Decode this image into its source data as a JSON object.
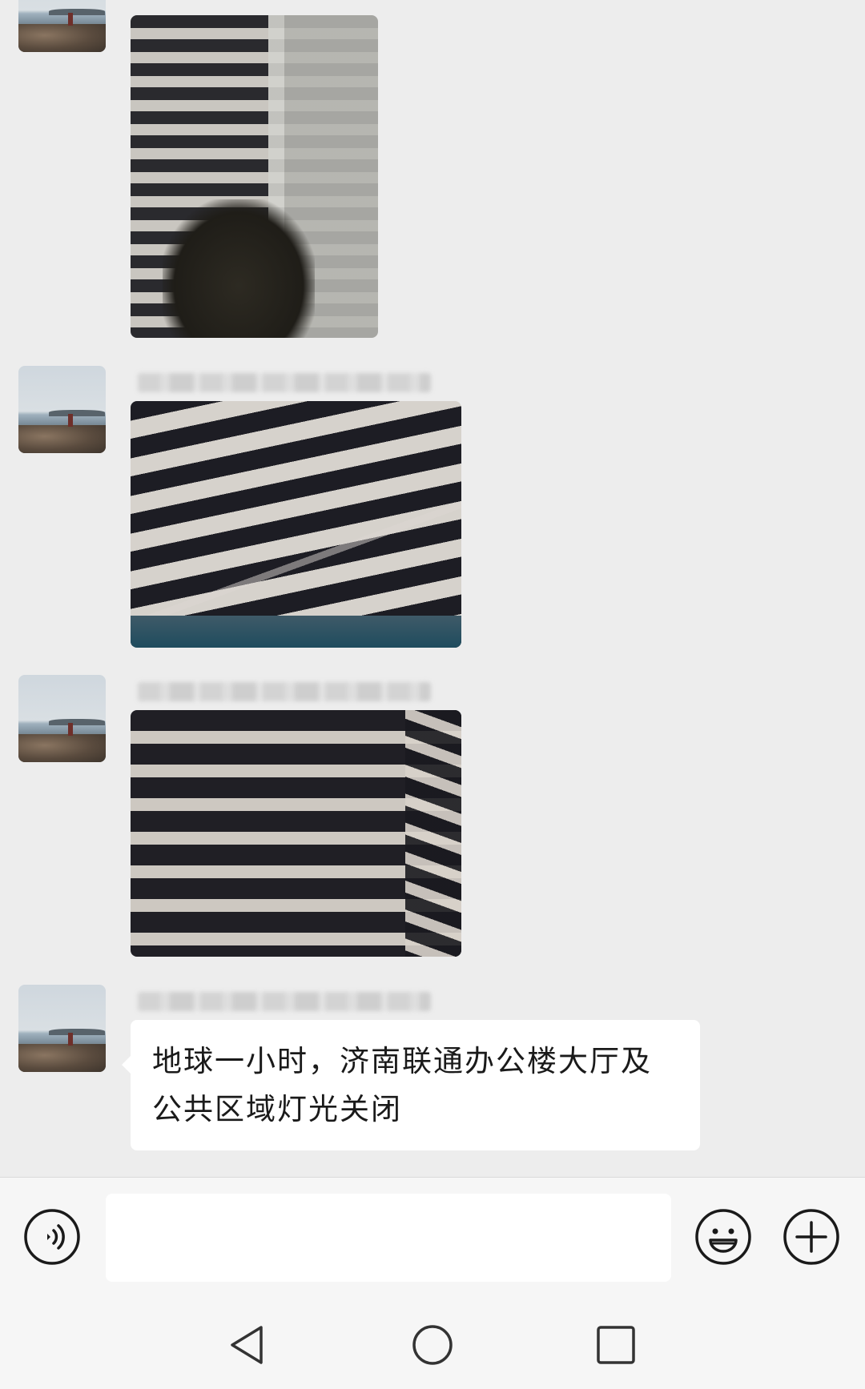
{
  "messages": [
    {
      "type": "image",
      "content": "night photo of office building facade"
    },
    {
      "type": "image",
      "content": "night photo of office building facade"
    },
    {
      "type": "image",
      "content": "night photo of office building facade"
    },
    {
      "type": "text",
      "lines": [
        "地球一小时，济南联通办公楼大厅及",
        "公共区域灯光关闭"
      ]
    }
  ],
  "input_bar": {
    "left_icon": "voice-icon",
    "text_value": "",
    "right_icons": [
      "emoji-icon",
      "plus-icon"
    ]
  },
  "nav_bar": {
    "icons": [
      "back-icon",
      "home-icon",
      "recents-icon"
    ]
  },
  "colors": {
    "chat_background": "#ededed",
    "bubble_background": "#ffffff",
    "bar_background": "#f6f6f6",
    "icon_stroke": "#1a1a1a"
  }
}
